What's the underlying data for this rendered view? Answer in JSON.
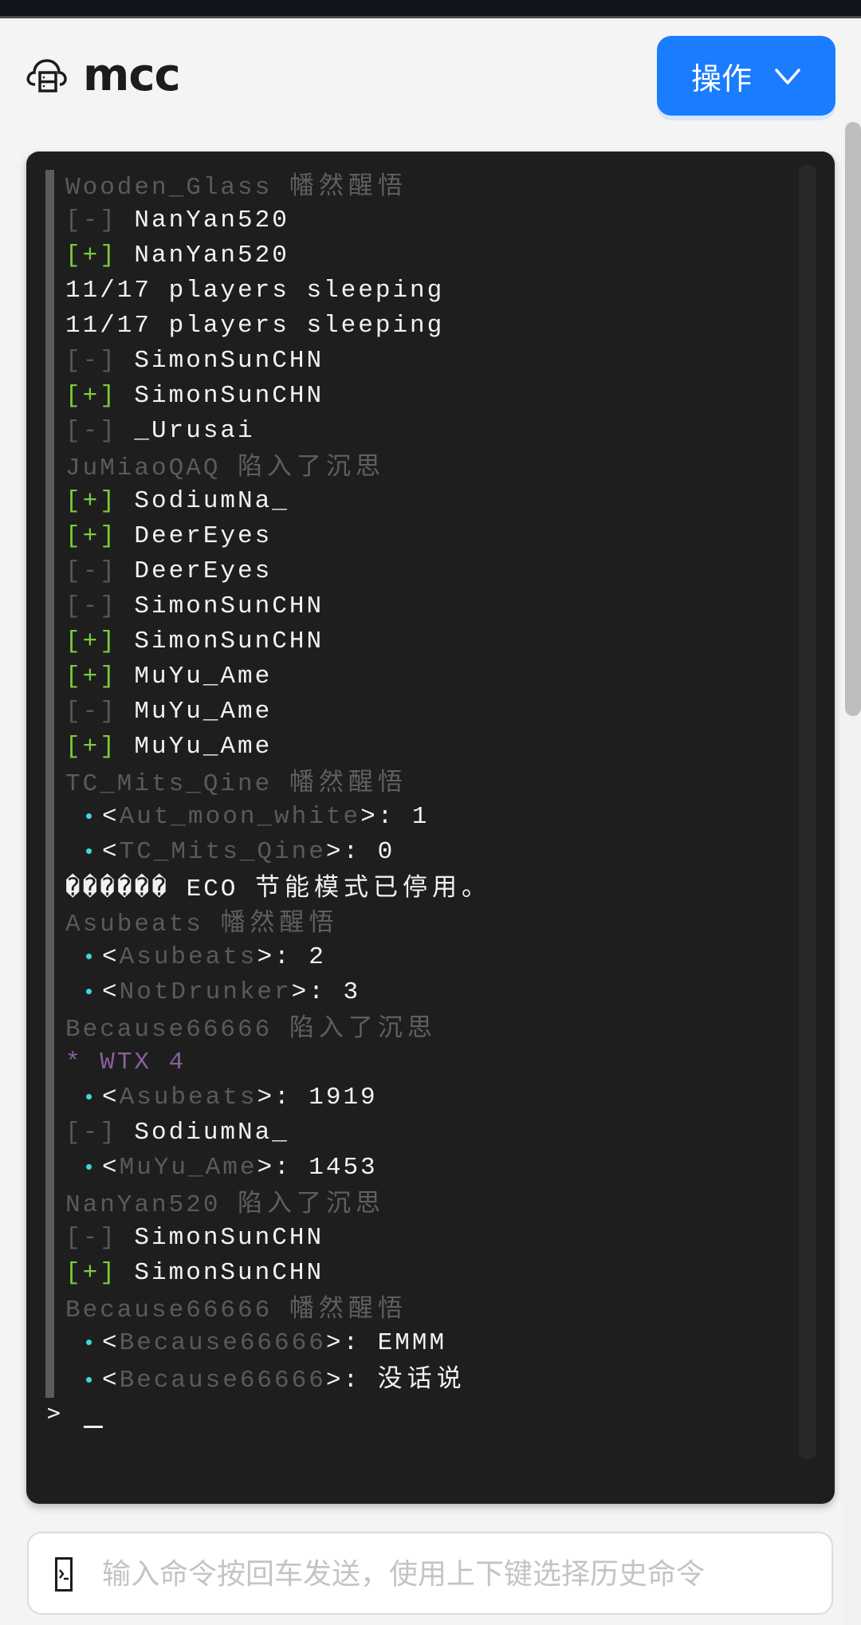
{
  "app": {
    "title": "mcc",
    "logo_icon": "cloud-server-icon"
  },
  "header": {
    "operations_button_label": "操作",
    "operations_button_icon": "chevron-down-icon",
    "accent_color": "#1a7cff"
  },
  "console": {
    "lines": [
      {
        "type": "event",
        "name": "Wooden_Glass",
        "action": "幡然醒悟"
      },
      {
        "type": "leave",
        "tag": "[-]",
        "name": "NanYan520"
      },
      {
        "type": "join",
        "tag": "[+]",
        "name": "NanYan520"
      },
      {
        "type": "plain",
        "text": "11/17 players sleeping"
      },
      {
        "type": "plain",
        "text": "11/17 players sleeping"
      },
      {
        "type": "leave",
        "tag": "[-]",
        "name": "SimonSunCHN"
      },
      {
        "type": "join",
        "tag": "[+]",
        "name": "SimonSunCHN"
      },
      {
        "type": "leave",
        "tag": "[-]",
        "name": "_Urusai"
      },
      {
        "type": "event",
        "name": "JuMiaoQAQ",
        "action": "陷入了沉思"
      },
      {
        "type": "join",
        "tag": "[+]",
        "name": "SodiumNa_"
      },
      {
        "type": "join",
        "tag": "[+]",
        "name": "DeerEyes"
      },
      {
        "type": "leave",
        "tag": "[-]",
        "name": "DeerEyes"
      },
      {
        "type": "leave",
        "tag": "[-]",
        "name": "SimonSunCHN"
      },
      {
        "type": "join",
        "tag": "[+]",
        "name": "SimonSunCHN"
      },
      {
        "type": "join",
        "tag": "[+]",
        "name": "MuYu_Ame"
      },
      {
        "type": "leave",
        "tag": "[-]",
        "name": "MuYu_Ame"
      },
      {
        "type": "join",
        "tag": "[+]",
        "name": "MuYu_Ame"
      },
      {
        "type": "event",
        "name": "TC_Mits_Qine",
        "action": "幡然醒悟"
      },
      {
        "type": "chat",
        "name": "Aut_moon_white",
        "message": "1"
      },
      {
        "type": "chat",
        "name": "TC_Mits_Qine",
        "message": "0"
      },
      {
        "type": "system",
        "garbled": "������",
        "prefix": "ECO",
        "text": "节能模式已停用。"
      },
      {
        "type": "event",
        "name": "Asubeats",
        "action": "幡然醒悟"
      },
      {
        "type": "chat",
        "name": "Asubeats",
        "message": "2"
      },
      {
        "type": "chat",
        "name": "NotDrunker",
        "message": "3"
      },
      {
        "type": "event",
        "name": "Because66666",
        "action": "陷入了沉思"
      },
      {
        "type": "me",
        "star": "*",
        "text": "WTX 4"
      },
      {
        "type": "chat",
        "name": "Asubeats",
        "message": "1919"
      },
      {
        "type": "leave",
        "tag": "[-]",
        "name": "SodiumNa_"
      },
      {
        "type": "chat",
        "name": "MuYu_Ame",
        "message": "1453"
      },
      {
        "type": "event",
        "name": "NanYan520",
        "action": "陷入了沉思"
      },
      {
        "type": "leave",
        "tag": "[-]",
        "name": "SimonSunCHN"
      },
      {
        "type": "join",
        "tag": "[+]",
        "name": "SimonSunCHN"
      },
      {
        "type": "event",
        "name": "Because66666",
        "action": "幡然醒悟"
      },
      {
        "type": "chat",
        "name": "Because66666",
        "message": "EMMM"
      },
      {
        "type": "chat",
        "name": "Because66666",
        "message": "没话说"
      }
    ],
    "prompt": ">",
    "colors": {
      "background": "#1e1e1e",
      "join_tag": "#7ccb3d",
      "bullet": "#3fd6dc",
      "me_action": "#8a5f9a"
    }
  },
  "command_input": {
    "icon": "terminal-icon",
    "placeholder": "输入命令按回车发送，使用上下键选择历史命令",
    "value": ""
  }
}
